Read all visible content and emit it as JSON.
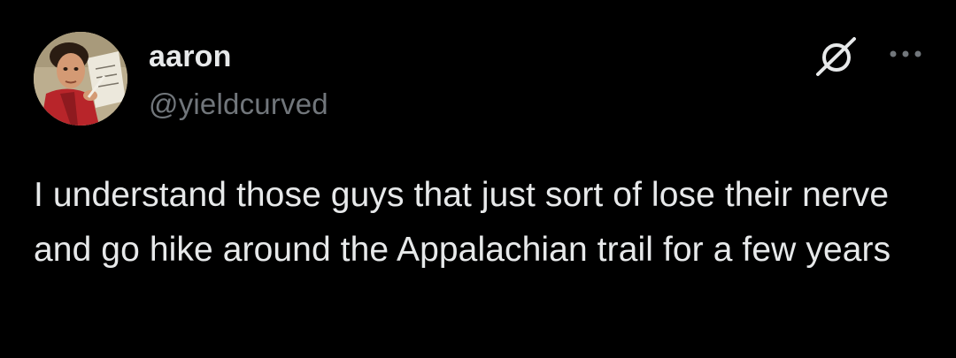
{
  "tweet": {
    "author": {
      "display_name": "aaron",
      "handle": "@yieldcurved"
    },
    "text": "I understand those guys that just sort of lose their nerve and go hike around the Appalachian trail for a few years",
    "icons": {
      "grok": "grok-icon",
      "more": "more-icon"
    }
  },
  "colors": {
    "background": "#000000",
    "primary_text": "#e7e9ea",
    "secondary_text": "#71767b"
  }
}
